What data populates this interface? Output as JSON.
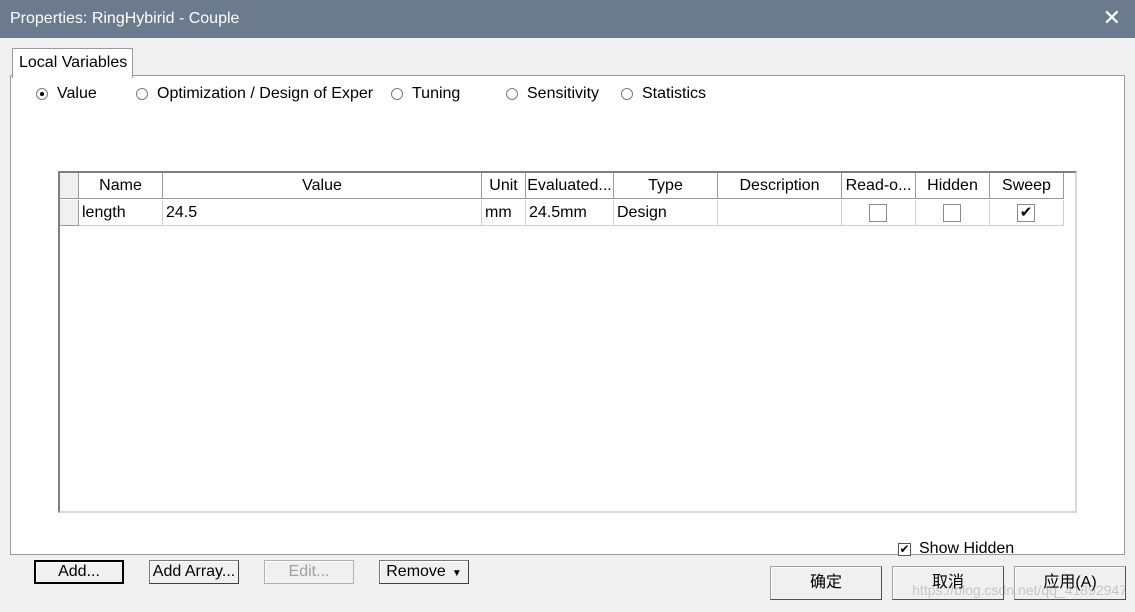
{
  "window": {
    "title": "Properties: RingHybirid - Couple"
  },
  "tabs": [
    {
      "label": "Local Variables"
    }
  ],
  "modes": [
    {
      "label": "Value",
      "selected": true
    },
    {
      "label": "Optimization / Design of Exper",
      "selected": false
    },
    {
      "label": "Tuning",
      "selected": false
    },
    {
      "label": "Sensitivity",
      "selected": false
    },
    {
      "label": "Statistics",
      "selected": false
    }
  ],
  "table": {
    "columns": [
      "Name",
      "Value",
      "Unit",
      "Evaluated...",
      "Type",
      "Description",
      "Read-o...",
      "Hidden",
      "Sweep"
    ],
    "rows": [
      {
        "name": "length",
        "value": "24.5",
        "unit": "mm",
        "evaluated": "24.5mm",
        "type": "Design",
        "description": "",
        "read_only": false,
        "hidden": false,
        "sweep": true
      }
    ]
  },
  "show_hidden": {
    "label": "Show Hidden",
    "checked": true
  },
  "buttons": {
    "add": "Add...",
    "add_array": "Add Array...",
    "edit": "Edit...",
    "remove": "Remove"
  },
  "dialog_buttons": {
    "ok": "确定",
    "cancel": "取消",
    "apply": "应用(A)"
  },
  "watermark": "https://blog.csdn.net/qq_41892947",
  "icons": {
    "close": "close-icon",
    "dropdown": "dropdown-arrow-icon",
    "check": "checkmark-icon"
  }
}
